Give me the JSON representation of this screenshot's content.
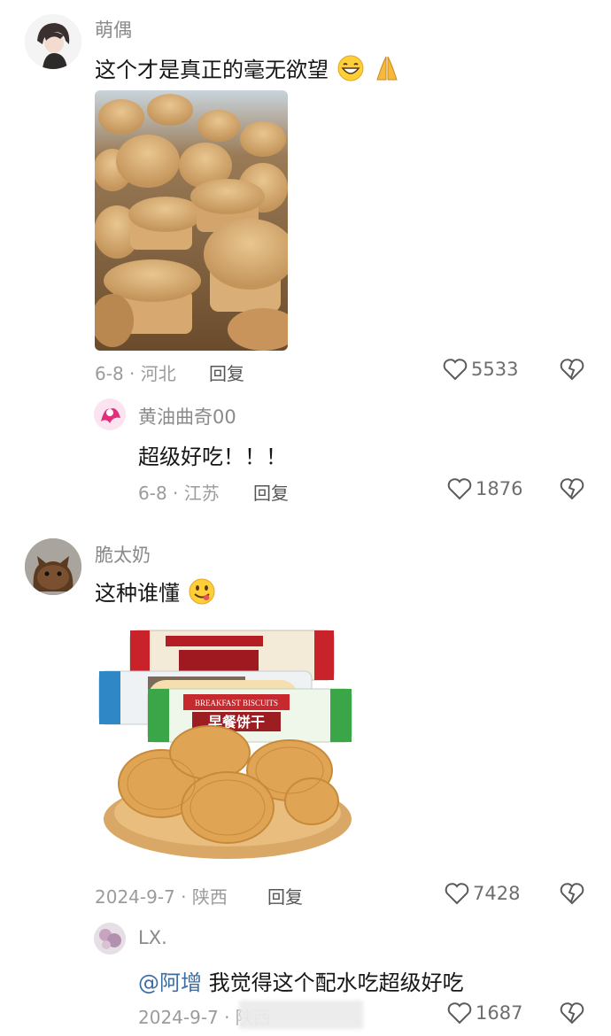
{
  "comments": [
    {
      "user": "萌偶",
      "text": "这个才是真正的毫无欲望",
      "meta": "6-8 · 河北",
      "reply_label": "回复",
      "likes": "5533"
    },
    {
      "user": "黄油曲奇00",
      "text": "超级好吃！！！",
      "meta": "6-8 · 江苏",
      "reply_label": "回复",
      "likes": "1876"
    },
    {
      "user": "脆太奶",
      "text": "这种谁懂",
      "meta": "2024-9-7 · 陕西",
      "reply_label": "回复",
      "likes": "7428"
    },
    {
      "user": "LX.",
      "mention": "@阿增",
      "text": "我觉得这个配水吃超级好吃",
      "meta": "2024-9-7 · 陕西",
      "likes": "1687"
    }
  ],
  "package_text": {
    "title_en": "BREAKFAST BISCUITS",
    "title_cn": "早餐饼干"
  },
  "icons": [
    "heart-icon",
    "broken-heart-icon"
  ]
}
